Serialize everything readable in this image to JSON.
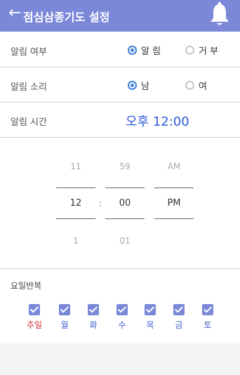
{
  "header": {
    "back_glyph": "←",
    "title": "점심삼종기도 설정",
    "bell_icon": "bell-icon",
    "bg": "#7b88d8"
  },
  "alarm_enable": {
    "label": "알림 여부",
    "options": [
      {
        "label": "알 림",
        "checked": true
      },
      {
        "label": "거 부",
        "checked": false
      }
    ]
  },
  "alarm_sound": {
    "label": "알림 소리",
    "options": [
      {
        "label": "남",
        "checked": true
      },
      {
        "label": "여",
        "checked": false
      }
    ]
  },
  "alarm_time": {
    "label": "알림 시간",
    "value": "오후 12:00"
  },
  "picker": {
    "hour": {
      "prev": "11",
      "selected": "12",
      "next": "1"
    },
    "separator": ":",
    "minute": {
      "prev": "59",
      "selected": "00",
      "next": "01"
    },
    "ampm": {
      "prev": "AM",
      "selected": "PM",
      "next": ""
    }
  },
  "repeat": {
    "label": "요일반복",
    "days": [
      {
        "label": "주일",
        "checked": true
      },
      {
        "label": "월",
        "checked": true
      },
      {
        "label": "화",
        "checked": true
      },
      {
        "label": "수",
        "checked": true
      },
      {
        "label": "목",
        "checked": true
      },
      {
        "label": "금",
        "checked": true
      },
      {
        "label": "토",
        "checked": true
      }
    ]
  }
}
